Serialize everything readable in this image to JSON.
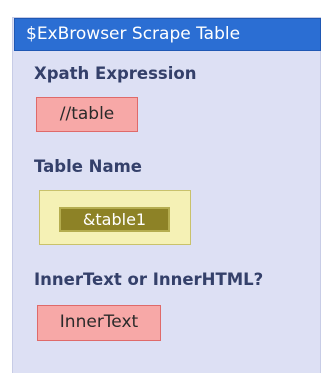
{
  "block": {
    "title": "$ExBrowser Scrape Table",
    "params": [
      {
        "label": "Xpath Expression",
        "value": "//table"
      },
      {
        "label": "Table Name",
        "value": "&table1"
      },
      {
        "label": "InnerText or InnerHTML?",
        "value": "InnerText"
      }
    ]
  },
  "colors": {
    "header": "#2b6ed3",
    "panel": "#dde0f4",
    "label_text": "#34406a",
    "string_field": "#f7a8a7",
    "variable_field_outer": "#f5f1b5",
    "variable_field_inner": "#8d8226"
  }
}
